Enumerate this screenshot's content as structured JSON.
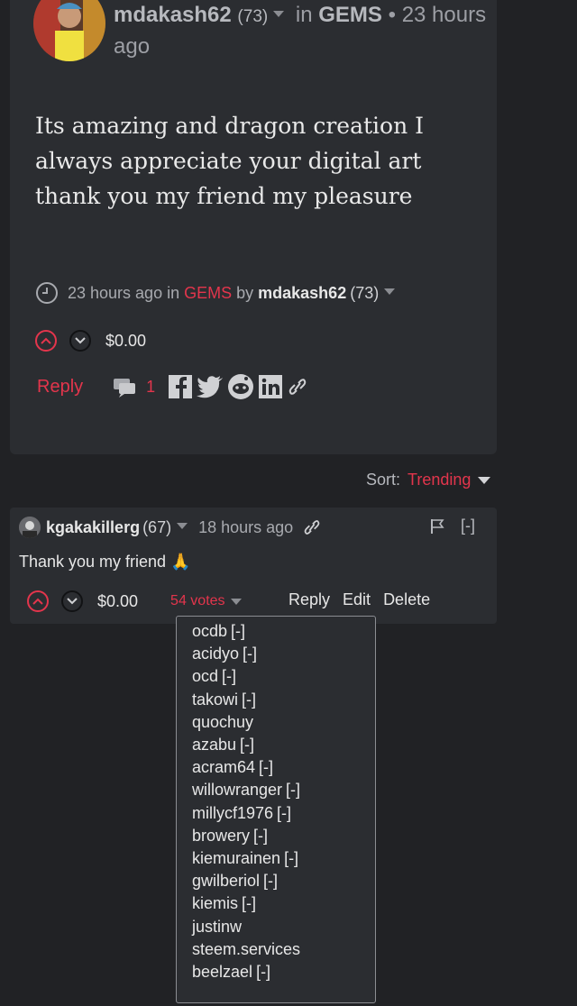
{
  "post": {
    "author": "mdakash62",
    "reputation": "(73)",
    "in_label": "in",
    "category": "GEMS",
    "separator": "•",
    "time_ago": "23 hours ago",
    "body": "Its amazing and dragon creation I always appreciate your digital art thank you my friend my pleasure",
    "meta": {
      "time": "23 hours ago",
      "in_label": "in",
      "category": "GEMS",
      "by_label": "by",
      "author": "mdakash62",
      "reputation": "(73)"
    },
    "payout": "$0.00",
    "reply_label": "Reply",
    "reply_count": "1"
  },
  "sort": {
    "label": "Sort:",
    "value": "Trending"
  },
  "comment": {
    "author": "kgakakillerg",
    "reputation": "(67)",
    "time_ago": "18 hours ago",
    "collapse_label": "[-]",
    "text": "Thank you my friend 🙏",
    "payout": "$0.00",
    "votes_label": "54 votes",
    "actions": {
      "reply": "Reply",
      "edit": "Edit",
      "delete": "Delete"
    }
  },
  "voters": [
    {
      "name": "ocdb",
      "mark": "[-]"
    },
    {
      "name": "acidyo",
      "mark": "[-]"
    },
    {
      "name": "ocd",
      "mark": "[-]"
    },
    {
      "name": "takowi",
      "mark": "[-]"
    },
    {
      "name": "quochuy",
      "mark": ""
    },
    {
      "name": "azabu",
      "mark": "[-]"
    },
    {
      "name": "acram64",
      "mark": "[-]"
    },
    {
      "name": "willowranger",
      "mark": "[-]"
    },
    {
      "name": "millycf1976",
      "mark": "[-]"
    },
    {
      "name": "browery",
      "mark": "[-]"
    },
    {
      "name": "kiemurainen",
      "mark": "[-]"
    },
    {
      "name": "gwilberiol",
      "mark": "[-]"
    },
    {
      "name": "kiemis",
      "mark": "[-]"
    },
    {
      "name": "justinw",
      "mark": ""
    },
    {
      "name": "steem.services",
      "mark": ""
    },
    {
      "name": "beelzael",
      "mark": "[-]"
    },
    {
      "name": "",
      "mark": ""
    }
  ],
  "colors": {
    "background": "#212225",
    "card": "#2b2d31",
    "accent": "#e3354c",
    "text": "#e7e7e7",
    "muted": "#a8aaaf"
  }
}
